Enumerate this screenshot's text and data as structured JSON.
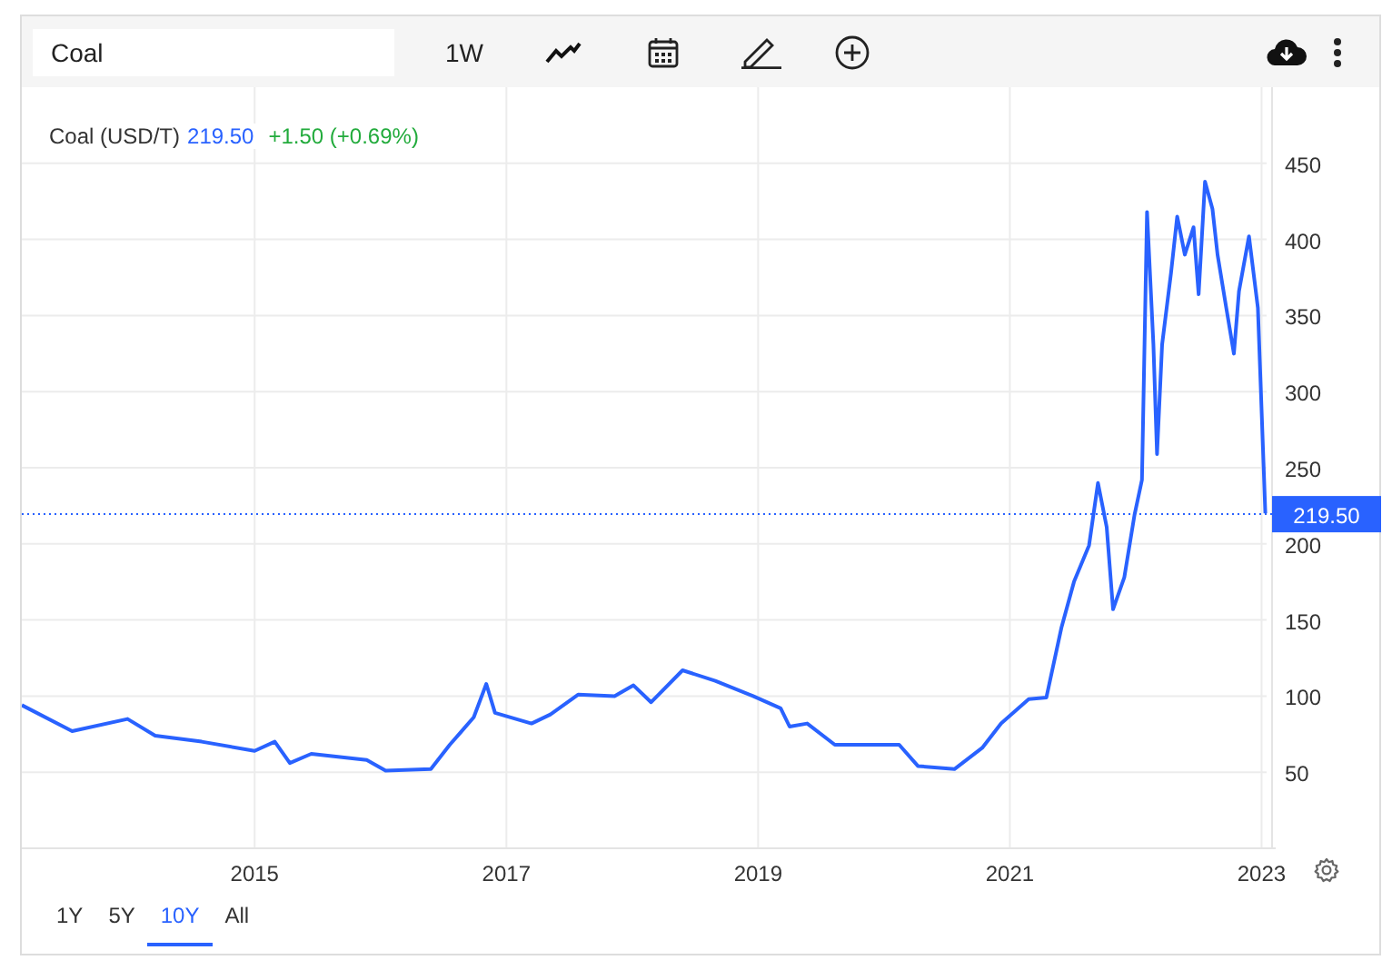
{
  "toolbar": {
    "search": {
      "value": "Coal"
    },
    "interval": "1W"
  },
  "legend": {
    "price": "219.50",
    "change": "+1.50 (+0.69%)"
  },
  "chart_data": {
    "type": "line",
    "grid": true,
    "xlim": [
      2013.15,
      2023.04
    ],
    "ylim": [
      0,
      500
    ],
    "ref_lines": [
      {
        "axis": "y",
        "value": 219.5,
        "label": "219.50",
        "color": "#2962ff"
      }
    ],
    "yticks": [
      50,
      100,
      150,
      200,
      250,
      300,
      350,
      400,
      450
    ],
    "xticks": [
      2015,
      2017,
      2019,
      2021,
      2023
    ],
    "x": [
      2013.15,
      2013.55,
      2013.99,
      2014.21,
      2014.58,
      2015.0,
      2015.16,
      2015.28,
      2015.45,
      2015.89,
      2016.04,
      2016.4,
      2016.55,
      2016.74,
      2016.84,
      2016.91,
      2017.2,
      2017.35,
      2017.57,
      2017.86,
      2018.01,
      2018.15,
      2018.4,
      2018.66,
      2018.96,
      2019.18,
      2019.25,
      2019.39,
      2019.61,
      2020.12,
      2020.27,
      2020.56,
      2020.78,
      2020.93,
      2021.15,
      2021.29,
      2021.41,
      2021.51,
      2021.63,
      2021.7,
      2021.77,
      2021.82,
      2021.91,
      2021.99,
      2022.05,
      2022.09,
      2022.14,
      2022.17,
      2022.21,
      2022.28,
      2022.33,
      2022.39,
      2022.46,
      2022.5,
      2022.55,
      2022.61,
      2022.65,
      2022.72,
      2022.78,
      2022.82,
      2022.9,
      2022.97,
      2023.03
    ],
    "series": [
      {
        "name": "Coal (USD/T)",
        "color": "#2962ff",
        "values": [
          94,
          77,
          85,
          74,
          70,
          64,
          70,
          56,
          62,
          58,
          51,
          52,
          68,
          86,
          108,
          89,
          82,
          88,
          101,
          100,
          107,
          96,
          117,
          110,
          100,
          92,
          80,
          82,
          68,
          68,
          54,
          52,
          66,
          82,
          98,
          99,
          145,
          175,
          199,
          240,
          211,
          157,
          178,
          219,
          242,
          418,
          331,
          259,
          331,
          378,
          415,
          390,
          408,
          364,
          438,
          420,
          390,
          355,
          325,
          366,
          402,
          355,
          220
        ]
      }
    ]
  },
  "ranges": [
    {
      "label": "1Y",
      "selected": false
    },
    {
      "label": "5Y",
      "selected": false
    },
    {
      "label": "10Y",
      "selected": true
    },
    {
      "label": "All",
      "selected": false
    }
  ]
}
